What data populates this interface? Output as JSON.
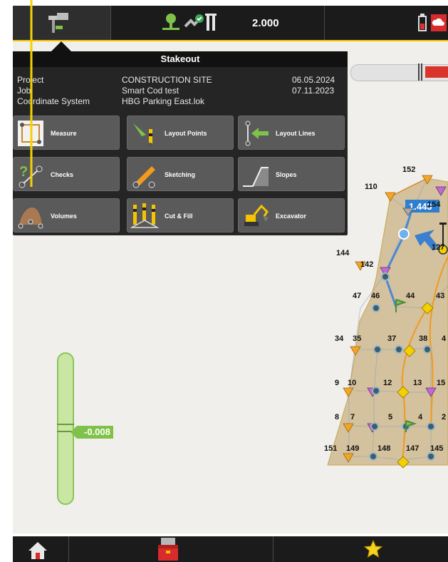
{
  "status": {
    "height_value": "2.000"
  },
  "menu": {
    "title": "Stakeout",
    "info": [
      {
        "label": "Project",
        "value": "CONSTRUCTION SITE",
        "date": "06.05.2024"
      },
      {
        "label": "Job",
        "value": "Smart Cod test",
        "date": "07.11.2023"
      },
      {
        "label": "Coordinate System",
        "value": "HBG Parking East.lok",
        "date": ""
      }
    ],
    "tiles": [
      {
        "label": "Measure",
        "icon": "measure-icon"
      },
      {
        "label": "Layout Points",
        "icon": "layout-points-icon"
      },
      {
        "label": "Layout Lines",
        "icon": "layout-lines-icon"
      },
      {
        "label": "Checks",
        "icon": "checks-icon"
      },
      {
        "label": "Sketching",
        "icon": "sketching-icon"
      },
      {
        "label": "Slopes",
        "icon": "slopes-icon"
      },
      {
        "label": "Volumes",
        "icon": "volumes-icon"
      },
      {
        "label": "Cut & Fill",
        "icon": "cut-fill-icon"
      },
      {
        "label": "Excavator",
        "icon": "excavator-icon"
      }
    ]
  },
  "map": {
    "distance_label": "1.443",
    "point_labels": [
      "152",
      "110",
      "154",
      "144",
      "142",
      "127",
      "47",
      "46",
      "44",
      "43",
      "34",
      "35",
      "37",
      "38",
      "4",
      "9",
      "10",
      "12",
      "13",
      "15",
      "8",
      "7",
      "5",
      "4",
      "2",
      "151",
      "149",
      "148",
      "147",
      "145"
    ]
  },
  "slider": {
    "value": "-0.008"
  },
  "colors": {
    "accent": "#f5c400",
    "slider_green": "#7fc24a",
    "distance_blue": "#2f7fd0"
  }
}
